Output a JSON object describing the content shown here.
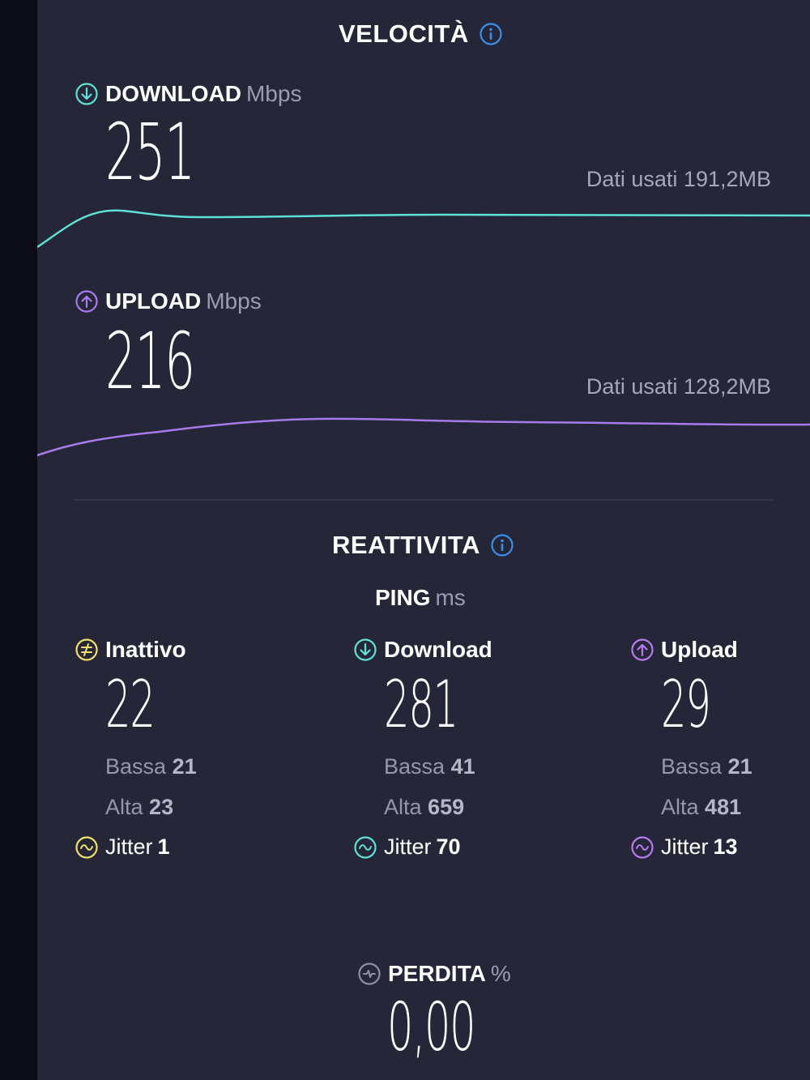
{
  "speed": {
    "title": "VELOCITÀ",
    "download": {
      "label": "DOWNLOAD",
      "unit": "Mbps",
      "value": "251",
      "data_used": "Dati usati 191,2MB",
      "color": "#5fe2d5"
    },
    "upload": {
      "label": "UPLOAD",
      "unit": "Mbps",
      "value": "216",
      "data_used": "Dati usati 128,2MB",
      "color": "#a77bea"
    }
  },
  "responsiveness": {
    "title": "REATTIVITA",
    "ping_label": "PING",
    "ping_unit": "ms",
    "columns": [
      {
        "label": "Inattivo",
        "value": "22",
        "low_label": "Bassa",
        "low": "21",
        "high_label": "Alta",
        "high": "23",
        "jitter_label": "Jitter",
        "jitter": "1",
        "color": "#f3df6b",
        "icon": "idle-icon"
      },
      {
        "label": "Download",
        "value": "281",
        "low_label": "Bassa",
        "low": "41",
        "high_label": "Alta",
        "high": "659",
        "jitter_label": "Jitter",
        "jitter": "70",
        "color": "#5fe2d5",
        "icon": "download-arrow-icon"
      },
      {
        "label": "Upload",
        "value": "29",
        "low_label": "Bassa",
        "low": "21",
        "high_label": "Alta",
        "high": "481",
        "jitter_label": "Jitter",
        "jitter": "13",
        "color": "#b57cf0",
        "icon": "upload-arrow-icon"
      }
    ]
  },
  "loss": {
    "label": "PERDITA",
    "unit": "%",
    "value": "0,00"
  },
  "colors": {
    "background": "#252739",
    "info": "#3b8ee8",
    "muted": "#9a9cb0"
  }
}
